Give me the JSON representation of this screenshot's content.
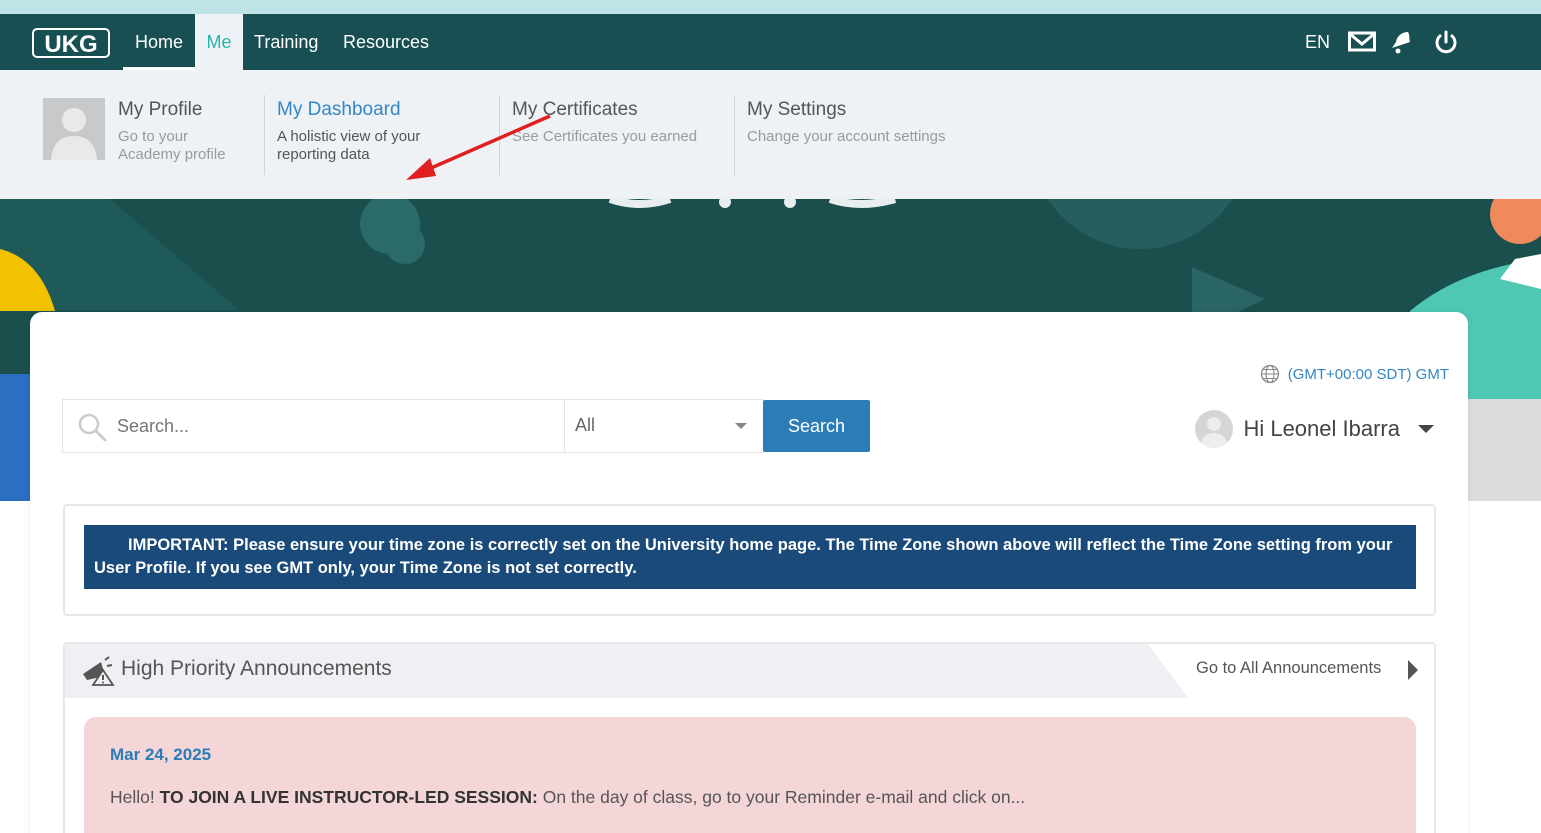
{
  "navbar": {
    "logo_text": "UKG",
    "items": [
      {
        "label": "Home"
      },
      {
        "label": "Me"
      },
      {
        "label": "Training"
      },
      {
        "label": "Resources"
      }
    ],
    "language": "EN",
    "icons": [
      "mail-icon",
      "bell-icon",
      "power-icon"
    ],
    "colors": {
      "bar": "#174f52",
      "active_tab_bg": "#eef2f6",
      "active_tab_text": "#2bb3a8"
    }
  },
  "me_menu": {
    "items": [
      {
        "title": "My Profile",
        "desc_1": "Go to your",
        "desc_2": "Academy profile"
      },
      {
        "title": "My Dashboard",
        "desc_1": "A holistic view of your",
        "desc_2": "reporting data"
      },
      {
        "title": "My Certificates",
        "desc_1": "See Certificates you earned",
        "desc_2": ""
      },
      {
        "title": "My Settings",
        "desc_1": "Change your account settings",
        "desc_2": ""
      }
    ],
    "active_item": "My Dashboard"
  },
  "timezone": "(GMT+00:00 SDT) GMT",
  "search": {
    "placeholder": "Search...",
    "filter_value": "All",
    "button_label": "Search"
  },
  "user": {
    "greeting": "Hi Leonel Ibarra"
  },
  "notice": {
    "text": "IMPORTANT: Please ensure your time zone is correctly set on the University home page.  The Time Zone shown above will reflect the Time Zone setting from your User Profile.  If you see GMT only, your Time Zone is not set correctly."
  },
  "announcements": {
    "title": "High Priority Announcements",
    "link_label": "Go to All Announcements",
    "items": [
      {
        "date": "Mar 24, 2025",
        "prefix": "Hello!  ",
        "bold": "TO JOIN A LIVE INSTRUCTOR-LED SESSION:",
        "rest": " On the day of class, go to your Reminder e-mail and click on..."
      }
    ]
  }
}
